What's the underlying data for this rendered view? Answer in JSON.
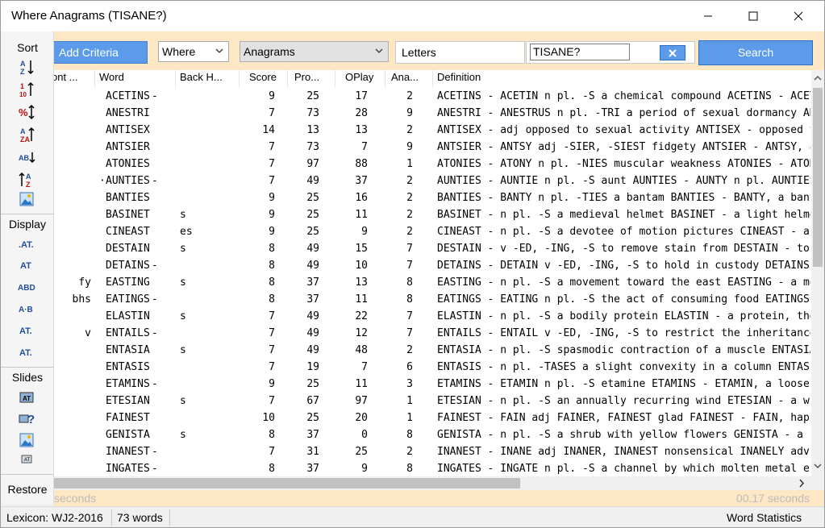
{
  "window": {
    "title": "Where Anagrams (TISANE?)"
  },
  "toolbar": {
    "add_criteria": "Add Criteria",
    "where_select": "Where",
    "type_select": "Anagrams",
    "letters_label": "Letters",
    "letters_value": "TISANE?",
    "clear_glyph": "X",
    "search": "Search"
  },
  "sidebar": {
    "sort_heading": "Sort",
    "display_heading": "Display",
    "slides_heading": "Slides",
    "restore": "Restore"
  },
  "columns": [
    "ont ...",
    "Word",
    "Back H...",
    "Score",
    "Pro...",
    "OPlay",
    "Ana...",
    "Definition"
  ],
  "rows": [
    {
      "front": "",
      "word": "ACETINS",
      "dot": "-",
      "back": "",
      "score": "9",
      "prob": "25",
      "oplay": "17",
      "ana": "2",
      "def": "ACETINS - ACETIN n pl. -S a chemical compound ACETINS - ACETIN"
    },
    {
      "front": "",
      "word": "ANESTRI",
      "dot": "",
      "back": "",
      "score": "7",
      "prob": "73",
      "oplay": "28",
      "ana": "9",
      "def": "ANESTRI - ANESTRUS n pl. -TRI a period of sexual dormancy ANESTRI"
    },
    {
      "front": "",
      "word": "ANTISEX",
      "dot": "",
      "back": "",
      "score": "14",
      "prob": "13",
      "oplay": "13",
      "ana": "2",
      "def": "ANTISEX - adj opposed to sexual activity ANTISEX - opposed to"
    },
    {
      "front": "",
      "word": "ANTSIER",
      "dot": "",
      "back": "",
      "score": "7",
      "prob": "73",
      "oplay": "7",
      "ana": "9",
      "def": "ANTSIER - ANTSY adj -SIER, -SIEST fidgety ANTSIER - ANTSY, adj"
    },
    {
      "front": "",
      "word": "ATONIES",
      "dot": "",
      "back": "",
      "score": "7",
      "prob": "97",
      "oplay": "88",
      "ana": "1",
      "def": "ATONIES - ATONY n pl. -NIES muscular weakness ATONIES - ATONY n"
    },
    {
      "front": "",
      "word": "AUNTIES",
      "dot": "-",
      "dotl": "·",
      "back": "",
      "score": "7",
      "prob": "49",
      "oplay": "37",
      "ana": "2",
      "def": "AUNTIES - AUNTIE n pl. -S aunt AUNTIES - AUNTY n pl. AUNTIES"
    },
    {
      "front": "",
      "word": "BANTIES",
      "dot": "",
      "back": "",
      "score": "9",
      "prob": "25",
      "oplay": "16",
      "ana": "2",
      "def": "BANTIES - BANTY n pl. -TIES a bantam BANTIES - BANTY, a bantam"
    },
    {
      "front": "",
      "word": "BASINET",
      "dot": "",
      "back": "s",
      "score": "9",
      "prob": "25",
      "oplay": "11",
      "ana": "2",
      "def": "BASINET - n pl. -S a medieval helmet BASINET - a light helmet"
    },
    {
      "front": "",
      "word": "CINEAST",
      "dot": "",
      "back": "es",
      "score": "9",
      "prob": "25",
      "oplay": "9",
      "ana": "2",
      "def": "CINEAST - n pl. -S a devotee of motion pictures CINEAST - a devot"
    },
    {
      "front": "",
      "word": "DESTAIN",
      "dot": "",
      "back": "s",
      "score": "8",
      "prob": "49",
      "oplay": "15",
      "ana": "7",
      "def": "DESTAIN - v -ED, -ING, -S to remove stain from DESTAIN - to remove"
    },
    {
      "front": "",
      "word": "DETAINS",
      "dot": "-",
      "back": "",
      "score": "8",
      "prob": "49",
      "oplay": "10",
      "ana": "7",
      "def": "DETAINS - DETAIN v -ED, -ING, -S to hold in custody DETAINS - DETAIN"
    },
    {
      "front": "fy",
      "word": "EASTING",
      "dot": "",
      "back": "s",
      "score": "8",
      "prob": "37",
      "oplay": "13",
      "ana": "8",
      "def": "EASTING - n pl. -S a movement toward the east EASTING - a movement"
    },
    {
      "front": "bhs",
      "word": "EATINGS",
      "dot": "-",
      "back": "",
      "score": "8",
      "prob": "37",
      "oplay": "11",
      "ana": "8",
      "def": "EATINGS - EATING n pl. -S the act of consuming food EATINGS - EATING"
    },
    {
      "front": "",
      "word": "ELASTIN",
      "dot": "",
      "back": "s",
      "score": "7",
      "prob": "49",
      "oplay": "22",
      "ana": "7",
      "def": "ELASTIN - n pl. -S a bodily protein ELASTIN - a protein, the chief"
    },
    {
      "front": "v",
      "word": "ENTAILS",
      "dot": "-",
      "back": "",
      "score": "7",
      "prob": "49",
      "oplay": "12",
      "ana": "7",
      "def": "ENTAILS - ENTAIL v -ED, -ING, -S to restrict the inheritance of"
    },
    {
      "front": "",
      "word": "ENTASIA",
      "dot": "",
      "back": "s",
      "score": "7",
      "prob": "49",
      "oplay": "48",
      "ana": "2",
      "def": "ENTASIA - n pl. -S spasmodic contraction of a muscle ENTASIA - a"
    },
    {
      "front": "",
      "word": "ENTASIS",
      "dot": "",
      "back": "",
      "score": "7",
      "prob": "19",
      "oplay": "7",
      "ana": "6",
      "def": "ENTASIS - n pl. -TASES a slight convexity in a column ENTASIS - a"
    },
    {
      "front": "",
      "word": "ETAMINS",
      "dot": "-",
      "back": "",
      "score": "9",
      "prob": "25",
      "oplay": "11",
      "ana": "3",
      "def": "ETAMINS - ETAMIN n pl. -S etamine ETAMINS - ETAMIN, a loosely woven"
    },
    {
      "front": "",
      "word": "ETESIAN",
      "dot": "",
      "back": "s",
      "score": "7",
      "prob": "67",
      "oplay": "97",
      "ana": "1",
      "def": "ETESIAN - n pl. -S an annually recurring wind ETESIAN - a wind"
    },
    {
      "front": "",
      "word": "FAINEST",
      "dot": "",
      "back": "",
      "score": "10",
      "prob": "25",
      "oplay": "20",
      "ana": "1",
      "def": "FAINEST - FAIN adj FAINER, FAINEST glad FAINEST - FAIN, happy"
    },
    {
      "front": "",
      "word": "GENISTA",
      "dot": "",
      "back": "s",
      "score": "8",
      "prob": "37",
      "oplay": "0",
      "ana": "8",
      "def": "GENISTA - n pl. -S a shrub with yellow flowers GENISTA - a shrub"
    },
    {
      "front": "",
      "word": "INANEST",
      "dot": "-",
      "back": "",
      "score": "7",
      "prob": "31",
      "oplay": "25",
      "ana": "2",
      "def": "INANEST - INANE adj INANER, INANEST nonsensical INANELY adv"
    },
    {
      "front": "",
      "word": "INGATES",
      "dot": "-",
      "back": "",
      "score": "8",
      "prob": "37",
      "oplay": "9",
      "ana": "8",
      "def": "INGATES - INGATE n pl. -S a channel by which molten metal enters"
    }
  ],
  "timebar": {
    "left": "seconds",
    "right": "00.17 seconds"
  },
  "status": {
    "lexicon": "Lexicon: WJ2-2016",
    "count": "73 words",
    "stats": "Word Statistics"
  }
}
